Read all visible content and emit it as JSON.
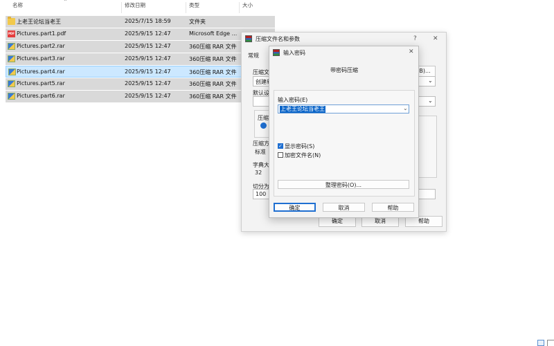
{
  "columns": {
    "name": "名称",
    "date": "修改日期",
    "type": "类型",
    "size": "大小"
  },
  "files": [
    {
      "name": "上老王论坛当老王",
      "date": "2025/7/15 18:59",
      "type": "文件夹",
      "icon": "folder-icon"
    },
    {
      "name": "Pictures.part1.pdf",
      "date": "2025/9/15 12:47",
      "type": "Microsoft Edge ...",
      "icon": "pdf-icon"
    },
    {
      "name": "Pictures.part2.rar",
      "date": "2025/9/15 12:47",
      "type": "360压缩 RAR 文件",
      "icon": "rar-icon"
    },
    {
      "name": "Pictures.part3.rar",
      "date": "2025/9/15 12:47",
      "type": "360压缩 RAR 文件",
      "icon": "rar-icon"
    },
    {
      "name": "Pictures.part4.rar",
      "date": "2025/9/15 12:47",
      "type": "360压缩 RAR 文件",
      "icon": "rar-icon",
      "selected": true
    },
    {
      "name": "Pictures.part5.rar",
      "date": "2025/9/15 12:47",
      "type": "360压缩 RAR 文件",
      "icon": "rar-icon"
    },
    {
      "name": "Pictures.part6.rar",
      "date": "2025/9/15 12:47",
      "type": "360压缩 RAR 文件",
      "icon": "rar-icon"
    }
  ],
  "archive_dialog": {
    "title": "压缩文件名和参数",
    "help_symbol": "?",
    "close_symbol": "✕",
    "tab_general": "常规",
    "label_archive_frag": "压缩文",
    "label_update_frag": "创建新",
    "label_default_frag": "默认设",
    "label_format_frag": "压缩",
    "label_method_frag": "压缩方",
    "method_value": "标准",
    "label_dict_frag": "字典大",
    "dict_value": "32",
    "label_split_frag": "切分为",
    "split_value": "100",
    "browse_frag": "(B)...",
    "ok": "确定",
    "cancel": "取消",
    "help": "帮助"
  },
  "password_dialog": {
    "title": "输入密码",
    "close_symbol": "✕",
    "heading": "带密码压缩",
    "password_label": "输入密码(E)",
    "password_value": "上老王论坛当老王",
    "show_password": "显示密码(S)",
    "show_password_checked": true,
    "encrypt_names": "加密文件名(N)",
    "encrypt_names_checked": false,
    "organize_button": "整理密码(O)...",
    "ok": "确定",
    "cancel": "取消",
    "help": "帮助"
  },
  "colors": {
    "row_bg": "#d9d9d9",
    "selected_row": "#cce8ff",
    "accent": "#1f6fd1"
  }
}
